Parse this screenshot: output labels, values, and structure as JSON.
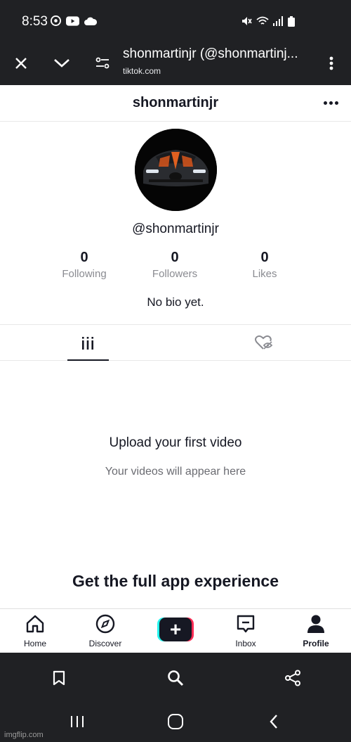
{
  "status_bar": {
    "time": "8:53",
    "icons_left": [
      "chrome-icon",
      "youtube-icon",
      "cloud-icon"
    ],
    "icons_right": [
      "mute-icon",
      "wifi-icon",
      "signal-icon",
      "battery-icon"
    ]
  },
  "browser": {
    "page_title": "shonmartinjr (@shonmartinj...",
    "domain": "tiktok.com",
    "icons": [
      "close-icon",
      "chevron-down-icon",
      "site-settings-icon",
      "overflow-menu-icon"
    ]
  },
  "profile": {
    "header_username": "shonmartinjr",
    "handle": "@shonmartinjr",
    "stats": [
      {
        "value": "0",
        "label": "Following"
      },
      {
        "value": "0",
        "label": "Followers"
      },
      {
        "value": "0",
        "label": "Likes"
      }
    ],
    "bio": "No bio yet."
  },
  "tabs": [
    {
      "icon": "videos-grid-icon",
      "active": true
    },
    {
      "icon": "liked-hidden-icon",
      "active": false
    }
  ],
  "empty_state": {
    "title": "Upload your first video",
    "subtitle": "Your videos will appear here"
  },
  "banner": {
    "text": "Get the full app experience"
  },
  "bottom_nav": [
    {
      "label": "Home",
      "icon": "home-icon"
    },
    {
      "label": "Discover",
      "icon": "compass-icon"
    },
    {
      "label": "",
      "icon": "create-plus-icon"
    },
    {
      "label": "Inbox",
      "icon": "inbox-icon"
    },
    {
      "label": "Profile",
      "icon": "profile-icon",
      "active": true
    }
  ],
  "browser_toolbar": [
    "bookmark-icon",
    "search-icon",
    "share-icon"
  ],
  "system_nav": [
    "recents-icon",
    "home-circle-icon",
    "back-icon"
  ],
  "watermark": "imgflip.com",
  "colors": {
    "dark_bar": "#202124",
    "text_primary": "#161823",
    "text_secondary": "#8a8b91",
    "accent_cyan": "#25f4ee",
    "accent_red": "#fe2c55"
  }
}
